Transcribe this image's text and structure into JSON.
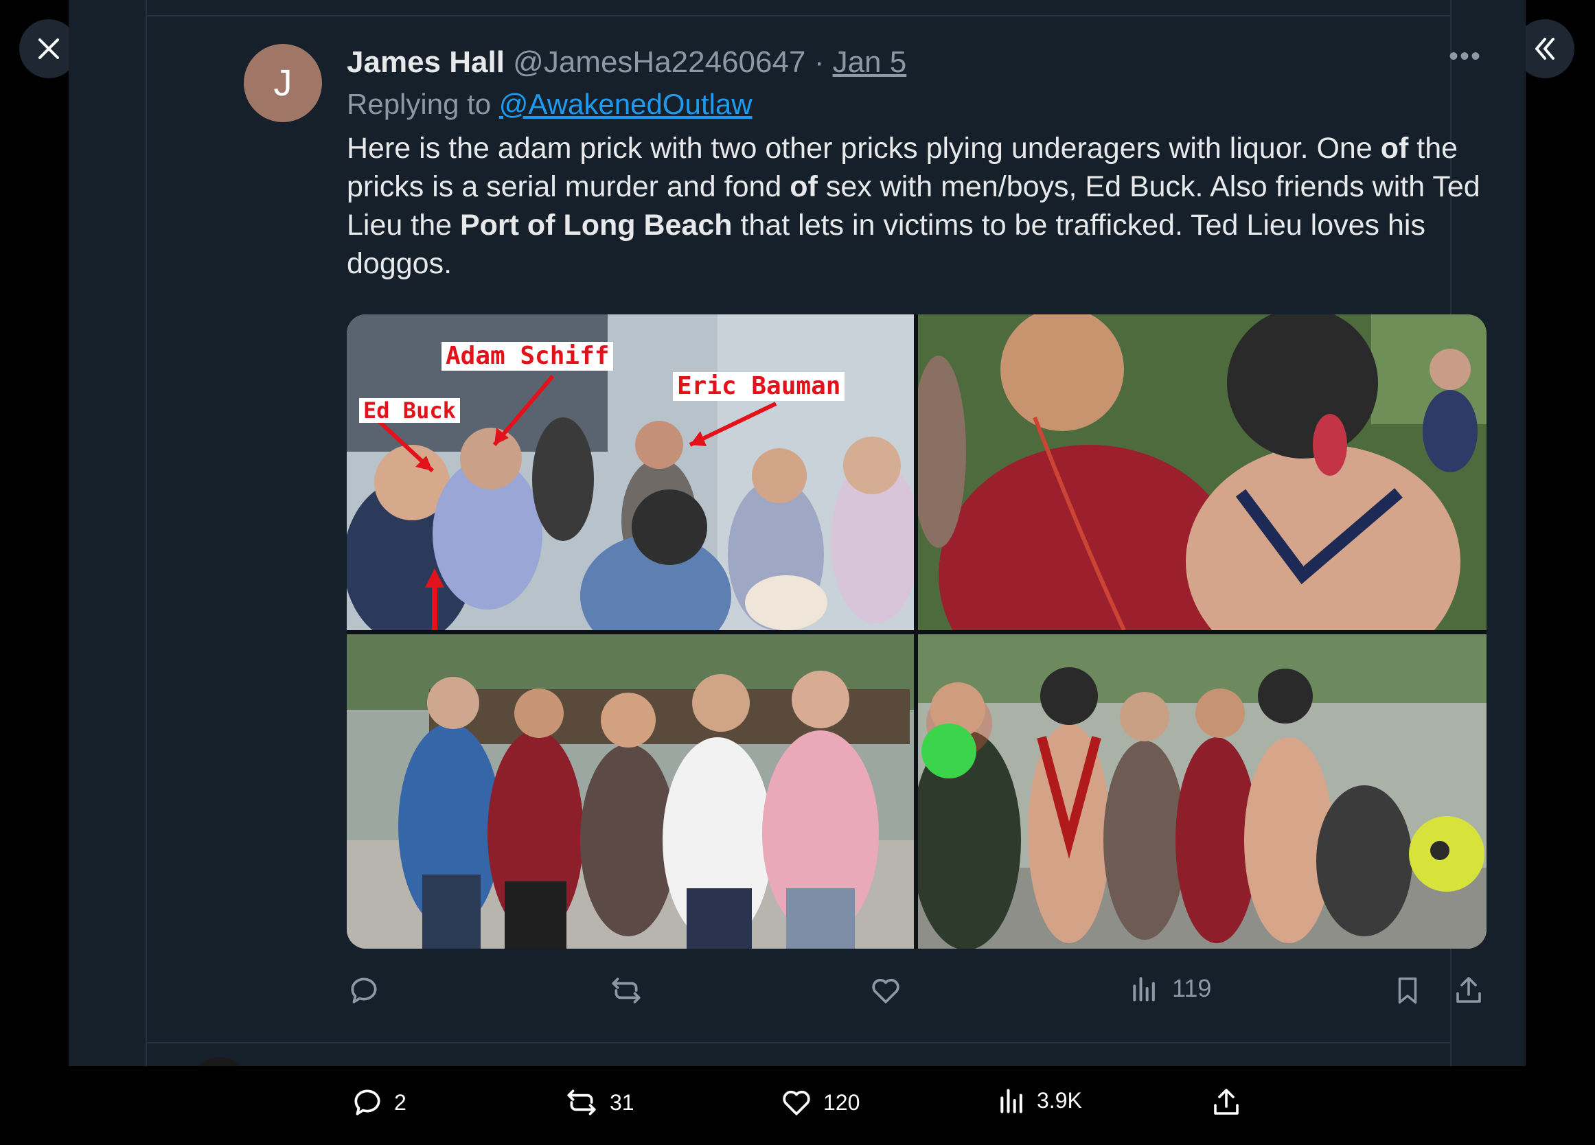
{
  "tweet": {
    "avatar_letter": "J",
    "author_name": "James Hall",
    "author_handle": "@JamesHa22460647",
    "separator": "·",
    "date": "Jan 5",
    "more_label": "•••",
    "replying_prefix": "Replying to",
    "replying_to": "@AwakenedOutlaw",
    "text_1": "Here is the adam prick with two other pricks plying underagers with liquor.  One ",
    "text_of1": "of",
    "text_2": " the pricks is a serial murder and fond ",
    "text_of2": "of",
    "text_3": " sex with men/boys, Ed Buck.  Also friends with Ted Lieu the ",
    "text_port": "Port of Long Beach",
    "text_4": " that lets in victims to be trafficked. Ted Lieu loves his doggos.",
    "photo_labels": [
      "Adam Schiff",
      "Eric Bauman",
      "Ed Buck"
    ],
    "views": "119"
  },
  "footer": {
    "replies": "2",
    "retweets": "31",
    "likes": "120",
    "views": "3.9K"
  },
  "colors": {
    "background": "#15202b",
    "accent": "#1d9bf0",
    "muted": "#8b98a5",
    "label_red": "#e3111a"
  },
  "icons": [
    "close-icon",
    "collapse-icon",
    "reply-icon",
    "retweet-icon",
    "like-icon",
    "views-icon",
    "bookmark-icon",
    "share-icon"
  ]
}
